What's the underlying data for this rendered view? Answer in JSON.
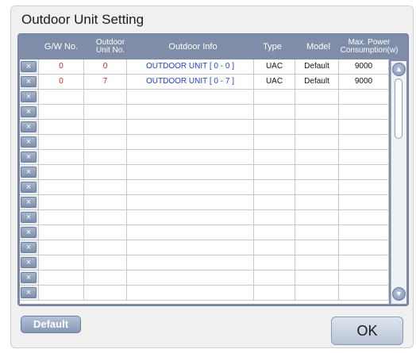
{
  "dialog": {
    "title": "Outdoor Unit Setting",
    "columns": {
      "gw_no": "G/W No.",
      "outdoor_unit_no": "Outdoor Unit No.",
      "outdoor_info": "Outdoor Info",
      "type": "Type",
      "model": "Model",
      "max_power": "Max. Power Consumption(w)"
    },
    "delete_glyph": "×",
    "rows": [
      {
        "gw_no": "0",
        "unit_no": "0",
        "info": "OUTDOOR UNIT [ 0 - 0 ]",
        "type": "UAC",
        "model": "Default",
        "power": "9000"
      },
      {
        "gw_no": "0",
        "unit_no": "7",
        "info": "OUTDOOR UNIT [ 0 - 7 ]",
        "type": "UAC",
        "model": "Default",
        "power": "9000"
      }
    ],
    "empty_row_count": 14,
    "default_button": "Default",
    "ok_button": "OK"
  },
  "colors": {
    "panel": "#7f8da8",
    "gw_red": "#e02020",
    "info_blue": "#1f3fd0"
  },
  "icons": {
    "delete": "close-icon",
    "scroll_up": "chevron-up-icon",
    "scroll_down": "chevron-down-icon"
  }
}
